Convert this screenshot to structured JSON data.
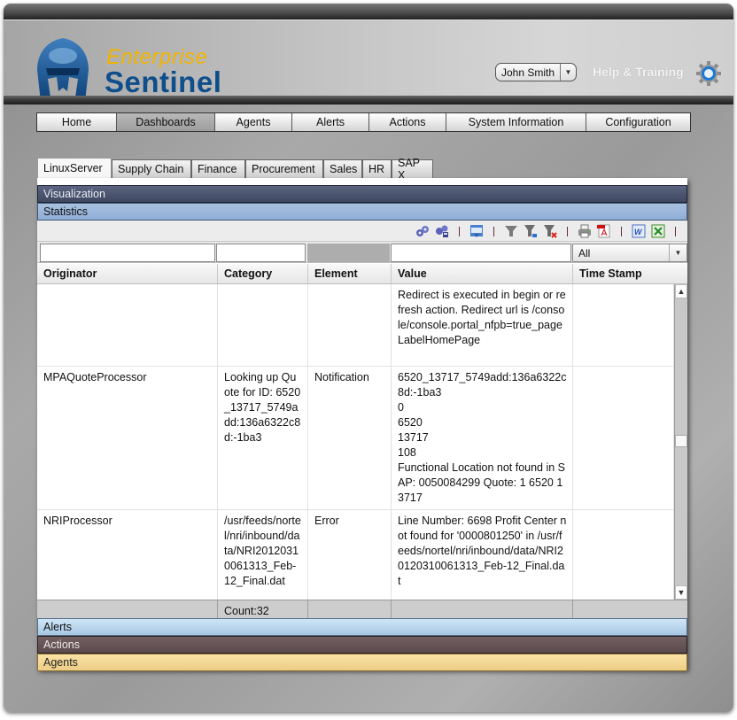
{
  "app": {
    "logo_line1": "Enterprise",
    "logo_line2": "Sentinel",
    "user_name": "John Smith",
    "help_label": "Help & Training"
  },
  "main_nav": [
    {
      "label": "Home",
      "active": false
    },
    {
      "label": "Dashboards",
      "active": true
    },
    {
      "label": "Agents",
      "active": false
    },
    {
      "label": "Alerts",
      "active": false
    },
    {
      "label": "Actions",
      "active": false
    },
    {
      "label": "System Information",
      "active": false
    },
    {
      "label": "Configuration",
      "active": false
    }
  ],
  "sub_tabs": [
    {
      "label": "LinuxServer",
      "active": true
    },
    {
      "label": "Supply Chain",
      "active": false
    },
    {
      "label": "Finance",
      "active": false
    },
    {
      "label": "Procurement",
      "active": false
    },
    {
      "label": "Sales",
      "active": false
    },
    {
      "label": "HR",
      "active": false
    },
    {
      "label": "SAP X",
      "active": false
    }
  ],
  "sections": {
    "visualization": "Visualization",
    "statistics": "Statistics",
    "alerts": "Alerts",
    "actions": "Actions",
    "agents": "Agents"
  },
  "toolbar_icons": [
    "gears-icon",
    "gears-save-icon",
    "calendar-icon",
    "filter-icon",
    "filter-add-icon",
    "filter-remove-icon",
    "print-icon",
    "pdf-icon",
    "word-icon",
    "excel-icon"
  ],
  "filters": {
    "originator": "",
    "category": "",
    "value": "",
    "timestamp_select": "All"
  },
  "table": {
    "columns": [
      "Originator",
      "Category",
      "Element",
      "Value",
      "Time Stamp"
    ],
    "rows": [
      {
        "originator": "",
        "category": "",
        "element": "",
        "value": "Redirect is executed in begin or refresh action. Redirect url is /console/console.portal_nfpb=true_pageLabelHomePage",
        "timestamp": ""
      },
      {
        "originator": "MPAQuoteProcessor",
        "category": "Looking up Quote for ID: 6520_13717_5749add:136a6322c8d:-1ba3",
        "element": "Notification",
        "value": "6520_13717_5749add:136a6322c8d:-1ba3\n0\n6520\n13717\n108\nFunctional Location not found in SAP: 0050084299 Quote: 1 6520 13717",
        "timestamp": ""
      },
      {
        "originator": "NRIProcessor",
        "category": "/usr/feeds/nortel/nri/inbound/data/NRI20120310061313_Feb-12_Final.dat",
        "element": "Error",
        "value": "Line Number: 6698 Profit Center not found for '0000801250' in /usr/feeds/nortel/nri/inbound/data/NRI20120310061313_Feb-12_Final.dat",
        "timestamp": ""
      }
    ],
    "footer_count": "Count:32"
  }
}
